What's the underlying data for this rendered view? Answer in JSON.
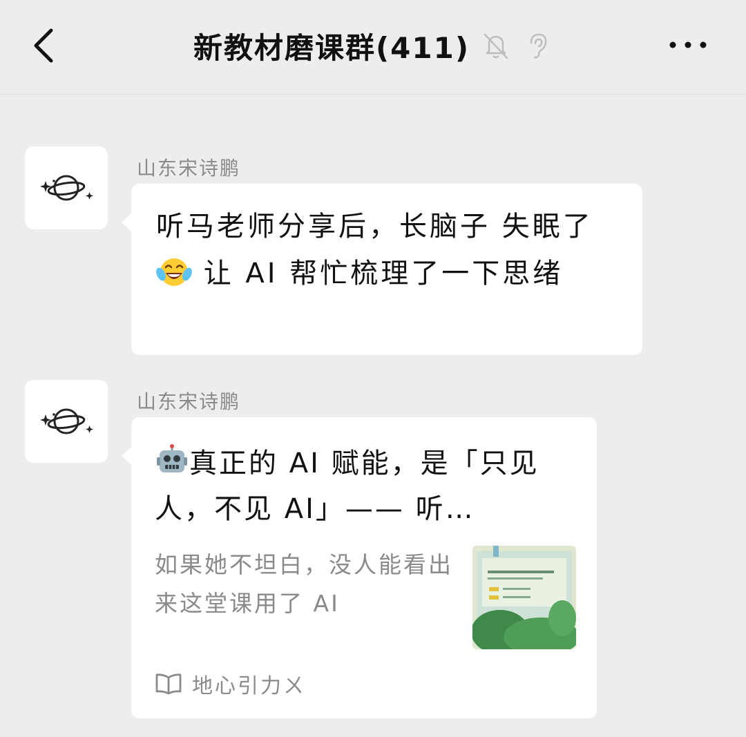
{
  "header": {
    "title": "新教材磨课群(411)",
    "icons": [
      "back-icon",
      "mute-bell-icon",
      "ear-icon",
      "more-icon"
    ]
  },
  "messages": [
    {
      "sender": "山东宋诗鹏",
      "avatar_icon": "planet-icon",
      "text_part1": "听马老师分享后，长脑子 失眠了",
      "emoji": "laughing-tears-emoji",
      "text_part2": " 让 AI 帮忙梳理了一下思绪"
    },
    {
      "sender": "山东宋诗鹏",
      "avatar_icon": "planet-icon",
      "card": {
        "title_icon": "robot-emoji",
        "title": "真正的 AI 赋能，是「只见人，不见 AI」—— 听…",
        "description": "如果她不坦白，没人能看出来这堂课用了 AI",
        "thumbnail_icon": "article-thumbnail",
        "source_icon": "book-icon",
        "source": "地心引力ㄨ"
      }
    }
  ],
  "colors": {
    "background": "#ededed",
    "bubble": "#ffffff",
    "secondary_text": "#8a8a8a"
  }
}
